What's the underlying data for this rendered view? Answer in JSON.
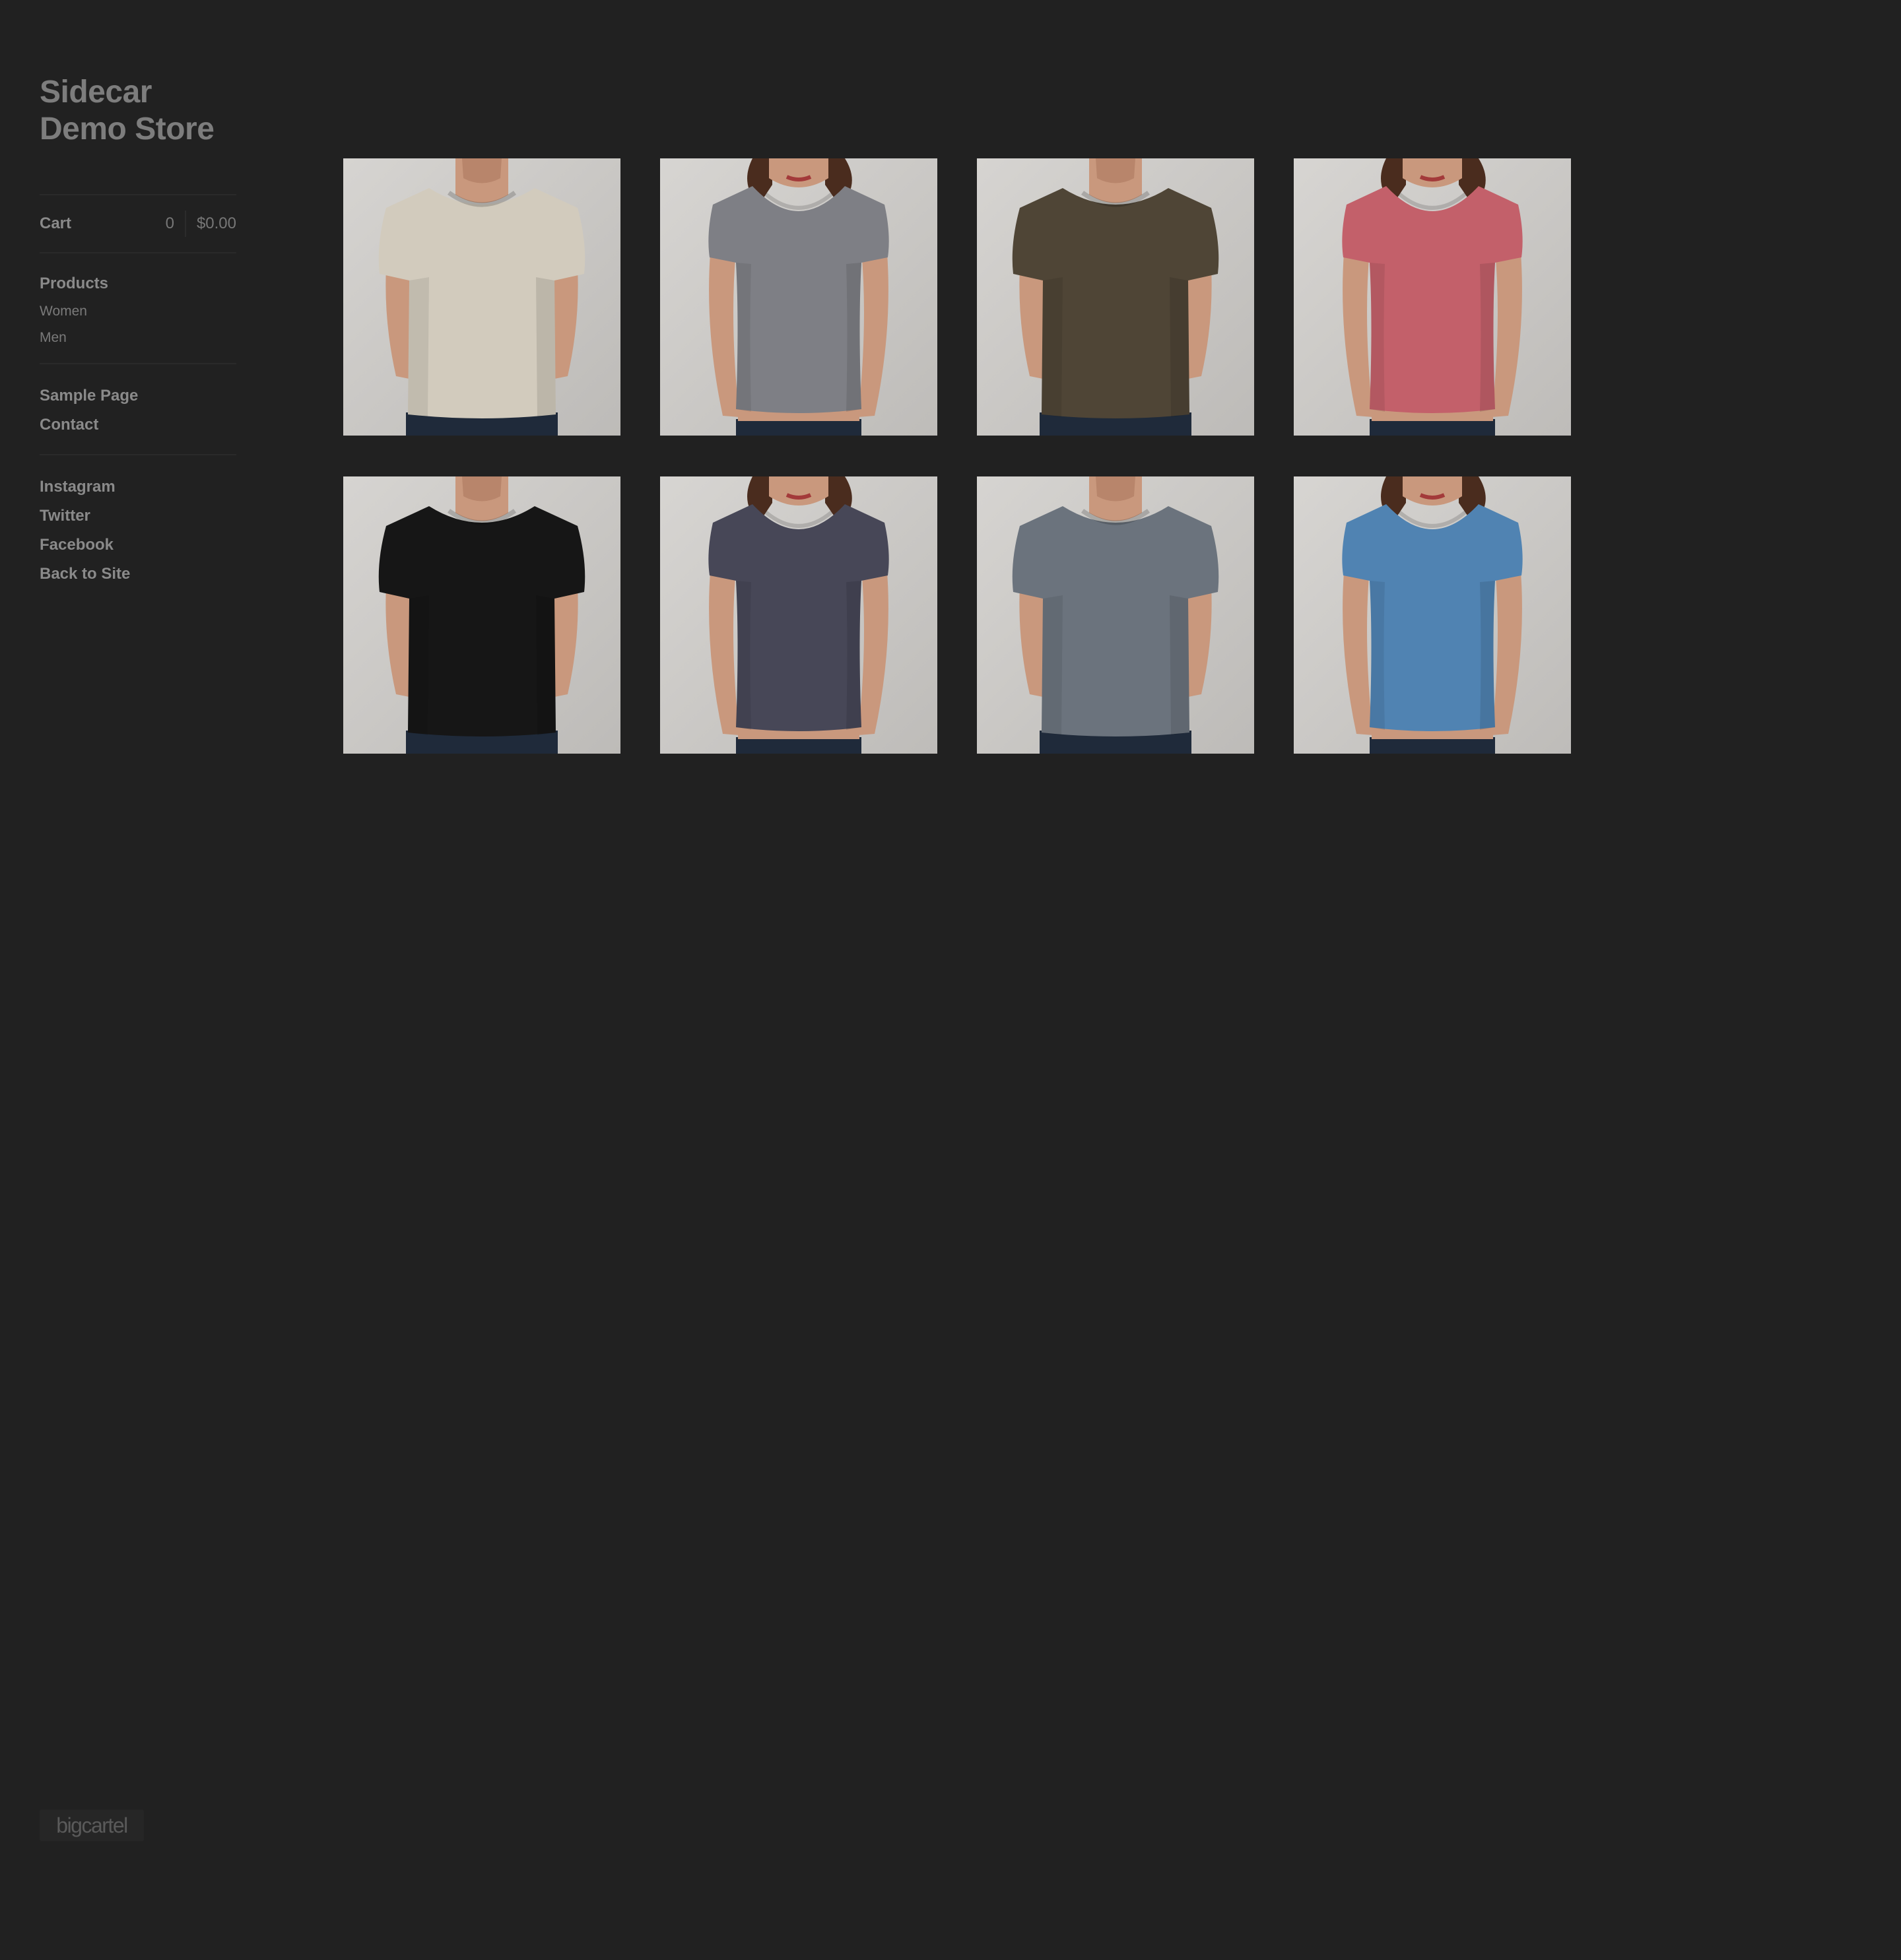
{
  "store": {
    "title_line1": "Sidecar",
    "title_line2": "Demo Store"
  },
  "cart": {
    "label": "Cart",
    "count": "0",
    "total": "$0.00"
  },
  "nav": {
    "products": "Products",
    "categories": [
      "Women",
      "Men"
    ],
    "pages": [
      "Sample Page",
      "Contact"
    ],
    "social": [
      "Instagram",
      "Twitter",
      "Facebook",
      "Back to Site"
    ]
  },
  "products": [
    {
      "model": "man",
      "shirt_color": "#d2cbbd"
    },
    {
      "model": "woman",
      "shirt_color": "#7e7f85"
    },
    {
      "model": "man",
      "shirt_color": "#4f4536"
    },
    {
      "model": "woman",
      "shirt_color": "#c3606a"
    },
    {
      "model": "man",
      "shirt_color": "#161616"
    },
    {
      "model": "woman",
      "shirt_color": "#474757"
    },
    {
      "model": "man",
      "shirt_color": "#6b737d"
    },
    {
      "model": "woman",
      "shirt_color": "#5083b2"
    }
  ],
  "footer": {
    "badge": "bigcartel"
  }
}
